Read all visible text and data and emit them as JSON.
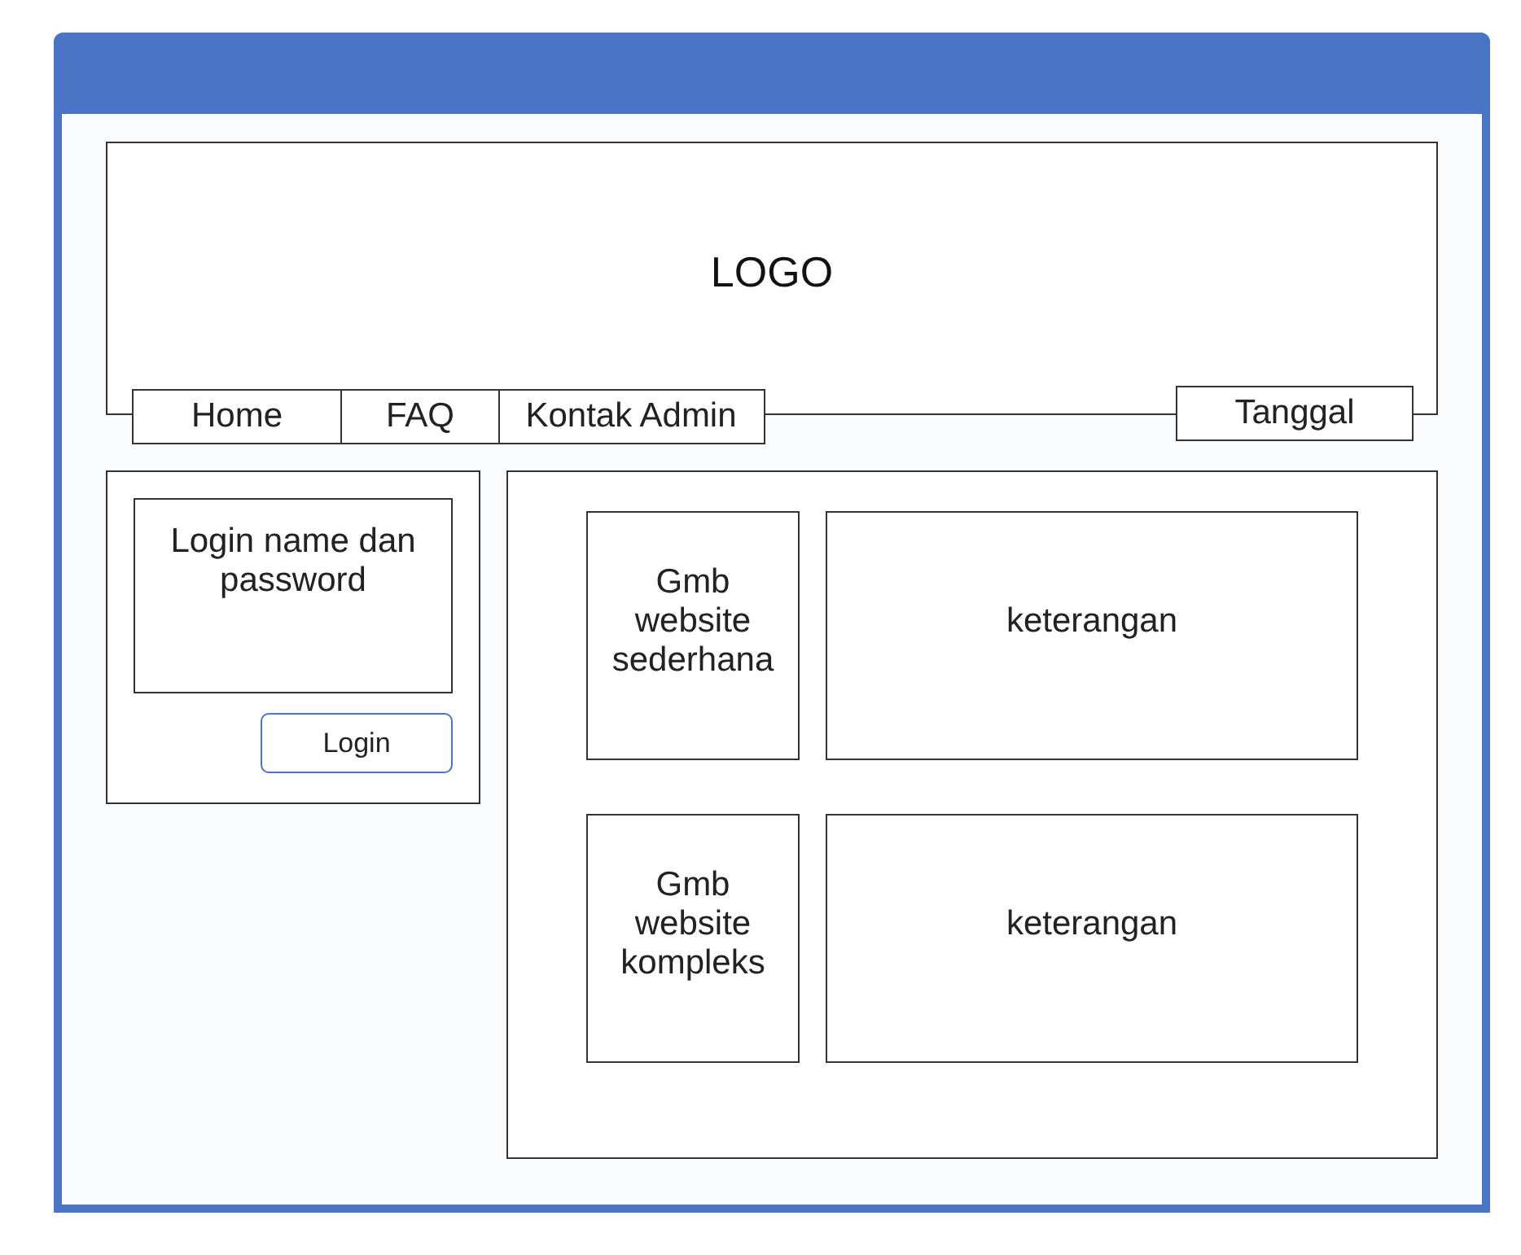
{
  "header": {
    "logo": "LOGO"
  },
  "nav": {
    "items": [
      "Home",
      "FAQ",
      "Kontak Admin"
    ],
    "date": "Tanggal"
  },
  "login": {
    "prompt": "Login name dan password",
    "button": "Login"
  },
  "content": {
    "rows": [
      {
        "image": "Gmb website sederhana",
        "description": "keterangan"
      },
      {
        "image": "Gmb website kompleks",
        "description": "keterangan"
      }
    ]
  }
}
